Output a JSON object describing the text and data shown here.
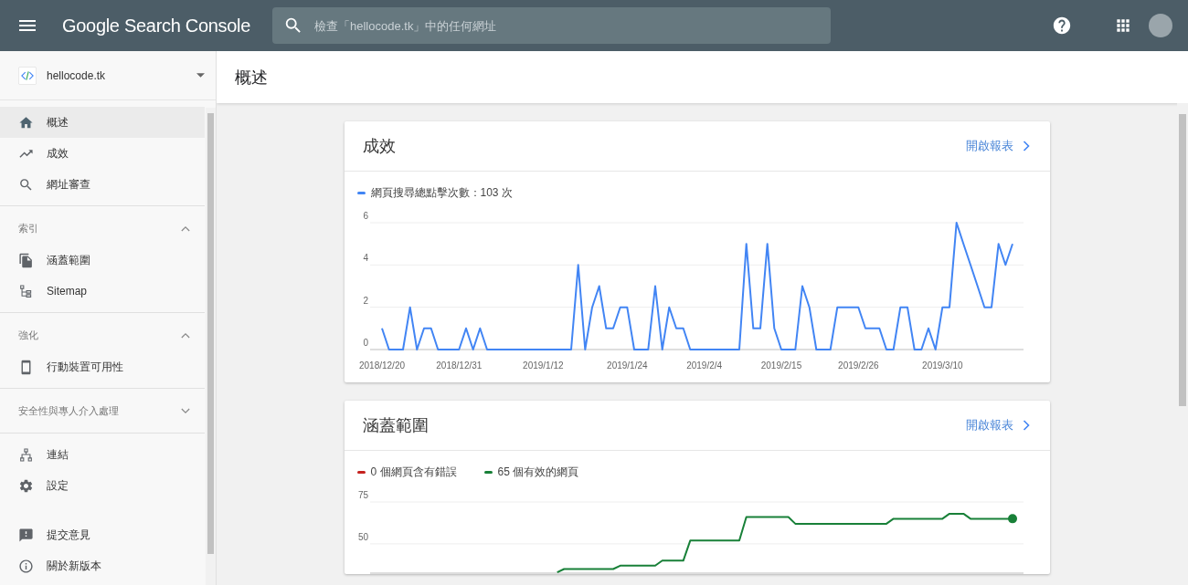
{
  "header": {
    "product": "Google Search Console",
    "search": {
      "placeholder": "檢查「hellocode.tk」中的任何網址"
    }
  },
  "sidebar": {
    "property": {
      "name": "hellocode.tk"
    },
    "groups": [
      {
        "items": [
          {
            "label": "概述",
            "selected": true
          },
          {
            "label": "成效",
            "selected": false
          },
          {
            "label": "網址審查",
            "selected": false
          }
        ]
      },
      {
        "heading": "索引",
        "expanded": true,
        "items": [
          {
            "label": "涵蓋範圍",
            "selected": false
          },
          {
            "label": "Sitemap",
            "selected": false
          }
        ]
      },
      {
        "heading": "強化",
        "expanded": true,
        "items": [
          {
            "label": "行動裝置可用性",
            "selected": false
          }
        ]
      },
      {
        "heading": "安全性與專人介入處理",
        "expanded": false
      },
      {
        "items": [
          {
            "label": "連結",
            "selected": false
          },
          {
            "label": "設定",
            "selected": false
          }
        ]
      },
      {
        "items": [
          {
            "label": "提交意見",
            "selected": false
          },
          {
            "label": "關於新版本",
            "selected": false
          }
        ]
      }
    ]
  },
  "page": {
    "title": "概述"
  },
  "cards": [
    {
      "title": "成效",
      "link": "開啟報表",
      "chart_data": {
        "type": "line",
        "ylim": [
          0,
          6
        ],
        "yticks": [
          0,
          2,
          4,
          6
        ],
        "categories": [
          "2018/12/20",
          null,
          null,
          null,
          null,
          null,
          null,
          null,
          null,
          null,
          null,
          "2018/12/31",
          null,
          null,
          null,
          null,
          null,
          null,
          null,
          null,
          null,
          null,
          null,
          "2019/1/12",
          null,
          null,
          null,
          null,
          null,
          null,
          null,
          null,
          null,
          null,
          null,
          "2019/1/24",
          null,
          null,
          null,
          null,
          null,
          null,
          null,
          null,
          null,
          null,
          "2019/2/4",
          null,
          null,
          null,
          null,
          null,
          null,
          null,
          null,
          null,
          null,
          "2019/2/15",
          null,
          null,
          null,
          null,
          null,
          null,
          null,
          null,
          null,
          null,
          "2019/2/26",
          null,
          null,
          null,
          null,
          null,
          null,
          null,
          null,
          null,
          null,
          null,
          "2019/3/10",
          null,
          null,
          null,
          null,
          null,
          null,
          null,
          null,
          null,
          null
        ],
        "series": [
          {
            "name": "網頁搜尋總點擊次數：103 次",
            "color": "#4285f4",
            "values": [
              1,
              0,
              0,
              0,
              2,
              0,
              1,
              1,
              0,
              0,
              0,
              0,
              1,
              0,
              1,
              0,
              0,
              0,
              0,
              0,
              0,
              0,
              0,
              0,
              0,
              0,
              0,
              0,
              4,
              0,
              2,
              3,
              1,
              1,
              2,
              2,
              0,
              0,
              0,
              3,
              0,
              2,
              1,
              1,
              0,
              0,
              0,
              0,
              0,
              0,
              0,
              0,
              5,
              1,
              1,
              5,
              1,
              0,
              0,
              0,
              3,
              2,
              0,
              0,
              0,
              2,
              2,
              2,
              2,
              1,
              1,
              1,
              0,
              0,
              2,
              2,
              0,
              0,
              1,
              0,
              2,
              2,
              6,
              5,
              4,
              3,
              2,
              2,
              5,
              4,
              5
            ]
          }
        ]
      }
    },
    {
      "title": "涵蓋範圍",
      "link": "開啟報表",
      "chart_data": {
        "type": "line",
        "ylim": [
          32,
          75
        ],
        "yticks": [
          50,
          75
        ],
        "series": [
          {
            "name": "0 個網頁含有錯誤",
            "color": "#c5221f",
            "values": [
              null,
              null,
              null,
              null,
              null,
              null,
              null,
              null,
              null,
              null,
              null,
              null,
              null,
              null,
              null,
              null,
              null,
              null,
              null,
              null,
              null,
              null,
              null,
              null,
              null,
              null,
              null,
              null,
              null,
              null,
              null,
              null,
              null,
              null,
              null,
              null,
              null,
              null,
              null,
              null,
              null,
              null,
              null,
              null,
              null,
              null,
              null,
              null,
              null,
              null,
              null,
              null,
              null,
              null,
              null,
              null,
              null,
              null,
              null,
              null,
              null,
              null,
              null,
              null,
              null,
              null,
              null,
              null,
              null,
              null,
              null,
              null,
              null,
              null,
              null,
              null,
              null,
              null,
              null,
              null,
              null,
              null,
              null,
              null,
              null,
              null,
              null,
              null,
              null,
              null,
              null
            ]
          },
          {
            "name": "65 個有效的網頁",
            "color": "#188038",
            "values": [
              null,
              null,
              null,
              null,
              null,
              null,
              null,
              null,
              null,
              null,
              null,
              null,
              null,
              null,
              null,
              null,
              null,
              null,
              null,
              null,
              null,
              null,
              null,
              null,
              null,
              33,
              35,
              35,
              35,
              35,
              35,
              35,
              35,
              35,
              37,
              37,
              37,
              37,
              37,
              37,
              40,
              40,
              40,
              40,
              52,
              52,
              52,
              52,
              52,
              52,
              52,
              52,
              66,
              66,
              66,
              66,
              66,
              66,
              66,
              62,
              62,
              62,
              62,
              62,
              62,
              62,
              62,
              62,
              62,
              62,
              62,
              62,
              62,
              65,
              65,
              65,
              65,
              65,
              65,
              65,
              65,
              68,
              68,
              68,
              65,
              65,
              65,
              65,
              65,
              65,
              65
            ]
          }
        ]
      }
    }
  ]
}
